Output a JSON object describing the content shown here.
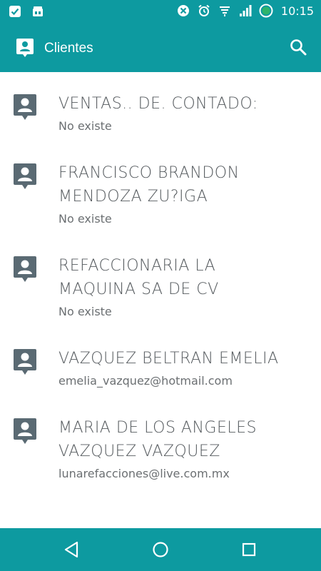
{
  "status_bar": {
    "time": "10:15"
  },
  "app_bar": {
    "title": "Clientes"
  },
  "clients": [
    {
      "name": "VENTAS.. DE. CONTADO:",
      "detail": "No existe"
    },
    {
      "name": "FRANCISCO BRANDON\nMENDOZA ZU?IGA",
      "detail": "No existe"
    },
    {
      "name": "REFACCIONARIA LA\nMAQUINA SA DE CV",
      "detail": "No existe"
    },
    {
      "name": "VAZQUEZ BELTRAN EMELIA",
      "detail": "emelia_vazquez@hotmail.com"
    },
    {
      "name": "MARIA DE LOS ANGELES\nVAZQUEZ VAZQUEZ",
      "detail": "lunarefacciones@live.com.mx"
    }
  ],
  "colors": {
    "primary": "#0d9aa0",
    "avatar": "#5a6a73",
    "text": "#555a5e"
  },
  "icons": {
    "app": "contact-card-icon",
    "search": "search-icon",
    "back": "back-triangle-icon",
    "home": "home-circle-icon",
    "recent": "recent-square-icon"
  }
}
